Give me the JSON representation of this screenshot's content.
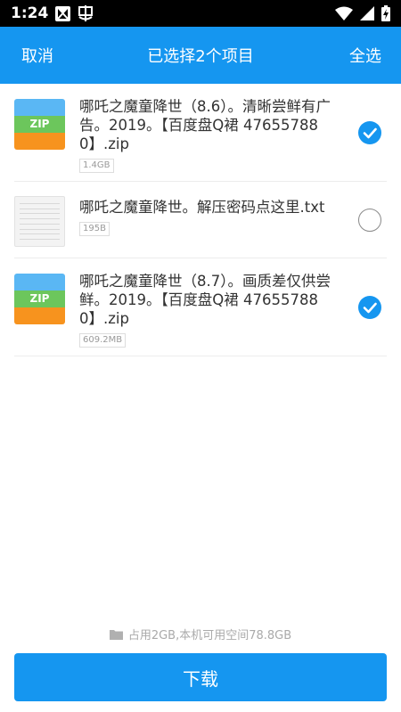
{
  "status_bar": {
    "time": "1:24"
  },
  "header": {
    "cancel_label": "取消",
    "title": "已选择2个项目",
    "select_all_label": "全选"
  },
  "files": [
    {
      "name": "哪吒之魔童降世（8.6）。清晰尝鲜有广告。2019。【百度盘Q裙 476557880】.zip",
      "size": "1.4GB",
      "type": "zip",
      "icon_label": "ZIP",
      "selected": true
    },
    {
      "name": "哪吒之魔童降世。解压密码点这里.txt",
      "size": "195B",
      "type": "txt",
      "selected": false
    },
    {
      "name": "哪吒之魔童降世（8.7）。画质差仅供尝鲜。2019。【百度盘Q裙 476557880】.zip",
      "size": "609.2MB",
      "type": "zip",
      "icon_label": "ZIP",
      "selected": true
    }
  ],
  "storage": {
    "text": "占用2GB,本机可用空间78.8GB"
  },
  "download_label": "下载",
  "colors": {
    "accent": "#1596f0",
    "status_bar": "#000000"
  }
}
